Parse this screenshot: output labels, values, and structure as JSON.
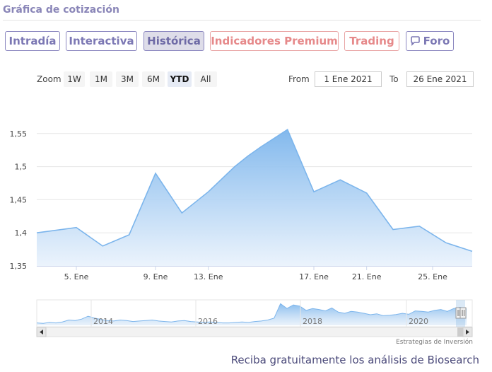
{
  "header": {
    "title": "Gráfica de cotización"
  },
  "tabs": [
    {
      "label": "Intradía",
      "style": "normal"
    },
    {
      "label": "Interactiva",
      "style": "normal"
    },
    {
      "label": "Histórica",
      "style": "active"
    },
    {
      "label": "Indicadores Premium",
      "style": "premium"
    },
    {
      "label": "Trading",
      "style": "premium"
    },
    {
      "label": "Foro",
      "style": "normal",
      "icon": "chat-icon"
    }
  ],
  "zoom": {
    "label": "Zoom",
    "buttons": [
      "1W",
      "1M",
      "3M",
      "6M",
      "YTD",
      "All"
    ],
    "selected": "YTD"
  },
  "range": {
    "from_label": "From",
    "from_value": "1 Ene 2021",
    "to_label": "To",
    "to_value": "26 Ene 2021"
  },
  "chart_data": {
    "type": "area",
    "x": [
      1,
      4,
      6,
      8,
      10,
      12,
      14,
      16,
      17,
      18,
      19,
      20,
      22,
      24,
      26,
      28,
      30,
      32,
      34
    ],
    "values": [
      1.4,
      1.408,
      1.38,
      1.397,
      1.49,
      1.43,
      1.462,
      1.5,
      1.516,
      1.53,
      1.543,
      1.556,
      1.462,
      1.48,
      1.46,
      1.405,
      1.41,
      1.385,
      1.372
    ],
    "ylim": [
      1.35,
      1.6
    ],
    "xlim": [
      1,
      34
    ],
    "yticks": [
      "1,35",
      "1,4",
      "1,45",
      "1,5",
      "1,55"
    ],
    "xticks": [
      {
        "x": 4,
        "label": "5. Ene"
      },
      {
        "x": 10,
        "label": "9. Ene"
      },
      {
        "x": 14,
        "label": "13. Ene"
      },
      {
        "x": 22,
        "label": "17. Ene"
      },
      {
        "x": 26,
        "label": "21. Ene"
      },
      {
        "x": 31,
        "label": "25. Ene"
      }
    ],
    "grid": true,
    "colors": {
      "line": "#7cb5ec",
      "fill_top": "#7cb5ec",
      "fill_bottom": "#e9f2fc"
    },
    "navigator": {
      "year_labels": [
        "2014",
        "2016",
        "2018",
        "2020"
      ],
      "values": [
        0.1,
        0.08,
        0.12,
        0.1,
        0.14,
        0.22,
        0.2,
        0.26,
        0.38,
        0.3,
        0.24,
        0.2,
        0.18,
        0.22,
        0.2,
        0.16,
        0.18,
        0.2,
        0.22,
        0.18,
        0.16,
        0.14,
        0.18,
        0.2,
        0.16,
        0.14,
        0.12,
        0.14,
        0.12,
        0.1,
        0.1,
        0.12,
        0.14,
        0.12,
        0.16,
        0.18,
        0.22,
        0.3,
        0.9,
        0.7,
        0.85,
        0.8,
        0.62,
        0.7,
        0.66,
        0.6,
        0.72,
        0.55,
        0.5,
        0.58,
        0.55,
        0.5,
        0.44,
        0.48,
        0.4,
        0.42,
        0.45,
        0.5,
        0.46,
        0.6,
        0.58,
        0.55,
        0.62,
        0.66,
        0.58,
        0.7,
        0.75,
        0.68
      ]
    }
  },
  "footer": {
    "credit": "Estrategias de Inversión",
    "promo": "Reciba gratuitamente los análisis de Biosearch"
  }
}
